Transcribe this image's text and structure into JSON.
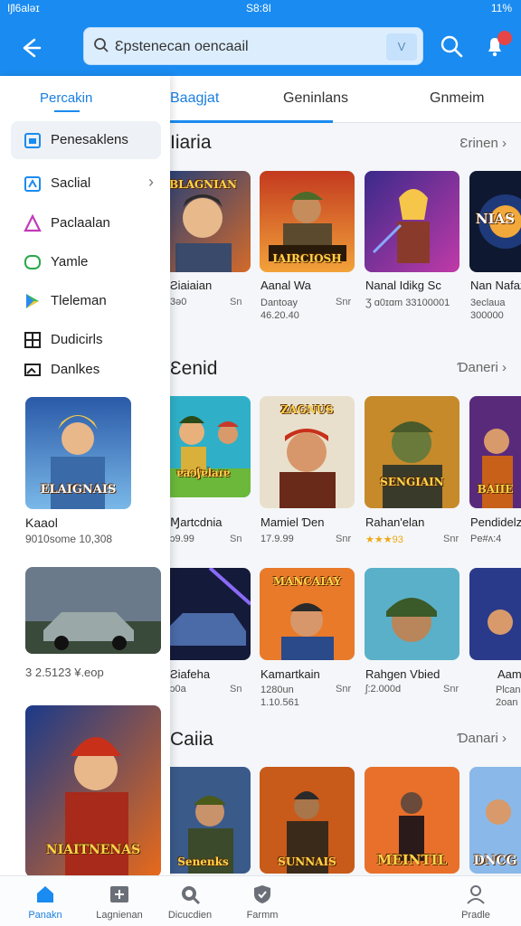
{
  "status": {
    "left": "Iʃl6aləɪ",
    "time": "S8:8I",
    "right": "11%"
  },
  "search": {
    "value": "Ɛpstenecan oencaail",
    "v_label": "V",
    "notify_count": ""
  },
  "tabs": [
    {
      "label": "Baagjat",
      "active": true
    },
    {
      "label": "Geninlans",
      "active": false
    },
    {
      "label": "Gnmeim",
      "active": false
    }
  ],
  "drawer": {
    "title": "Percakin",
    "items": [
      {
        "label": "Penesaklens",
        "icon": "store-icon"
      },
      {
        "label": "Saclial",
        "icon": "book-icon"
      },
      {
        "label": "Paclaalan",
        "icon": "triangle-icon"
      },
      {
        "label": "Yamle",
        "icon": "chat-icon"
      },
      {
        "label": "Tleleman",
        "icon": "play-store-icon"
      },
      {
        "label": "Dudicirls",
        "icon": "grid-icon"
      },
      {
        "label": "Danlkes",
        "icon": "image-icon"
      }
    ],
    "cards": [
      {
        "art_label": "ELAIGNAIS",
        "title": "Kaaol",
        "sub": "9010some 10,308"
      },
      {
        "art_label": "",
        "title": "",
        "sub": "3 2.5123 ¥.eop"
      },
      {
        "art_label": "NIAITNENAS",
        "title": "",
        "sub": ""
      }
    ]
  },
  "sections": [
    {
      "title": "Iiaria",
      "more": "Ɛrinen",
      "games": [
        {
          "art": "BLAGNIAN",
          "name": "Ƨiaiaian",
          "sub": "3ə0",
          "size": "Sn"
        },
        {
          "art": "IAIRCIOSH",
          "name": "Aanal Wa",
          "sub": "Dantoay 46.20.40",
          "size": "Snr"
        },
        {
          "art": "",
          "name": "Nanal Idikg Sc",
          "sub": "Ʒ ɑ0ɪɑm 33100001",
          "size": ""
        },
        {
          "art": "NIAS",
          "name": "Nan Nafaz",
          "sub": "3eclaua 300000",
          "size": ""
        }
      ]
    },
    {
      "title": "Ɛenid",
      "more": "Ɗaneri",
      "games": [
        {
          "art": "ɐaɔʃɐlaɪɐ",
          "name": "Ɱartcdnia",
          "sub": "ɔ9.99",
          "size": "Sn"
        },
        {
          "art": "ZAGNUS",
          "name": "Mamiel Ɗen",
          "sub": "17.9.99",
          "size": "Snr"
        },
        {
          "art": "SENGIAIN",
          "name": "Rahan'elan",
          "sub": "★★★93",
          "size": "Snr"
        },
        {
          "art": "BAIIE",
          "name": "Pendidelz",
          "sub": "Pe#ʌ:4",
          "size": ""
        }
      ]
    },
    {
      "title": "",
      "more": "",
      "games": [
        {
          "art": "",
          "name": "Ƨiafeha",
          "sub": "ɔ0a",
          "size": "Sn"
        },
        {
          "art": "MANCAIAY",
          "name": "Kamartkain",
          "sub": "1280un 1.10.561",
          "size": "Snr"
        },
        {
          "art": "",
          "name": "Rahgen Vbied",
          "sub": "ʃ:2.000d",
          "size": "Snr"
        },
        {
          "art": "",
          "name": "Aam",
          "sub": "Plcan 2oan",
          "size": ""
        }
      ]
    },
    {
      "title": "Caiia",
      "more": "Ɗanari",
      "games": [
        {
          "art": "Senenks",
          "name": "",
          "sub": "",
          "size": ""
        },
        {
          "art": "SUNNAIS",
          "name": "",
          "sub": "",
          "size": ""
        },
        {
          "art": "MEINTIL",
          "name": "",
          "sub": "",
          "size": ""
        },
        {
          "art": "DNCG",
          "name": "",
          "sub": "",
          "size": ""
        }
      ]
    }
  ],
  "bottom_nav": [
    {
      "label": "Panakn",
      "icon": "home-icon",
      "active": true
    },
    {
      "label": "Lagnienan",
      "icon": "apps-icon",
      "active": false
    },
    {
      "label": "Dicucdien",
      "icon": "search-icon",
      "active": false
    },
    {
      "label": "Farmm",
      "icon": "shield-check-icon",
      "active": false
    },
    {
      "label": "Pradle",
      "icon": "profile-icon",
      "active": false
    }
  ]
}
